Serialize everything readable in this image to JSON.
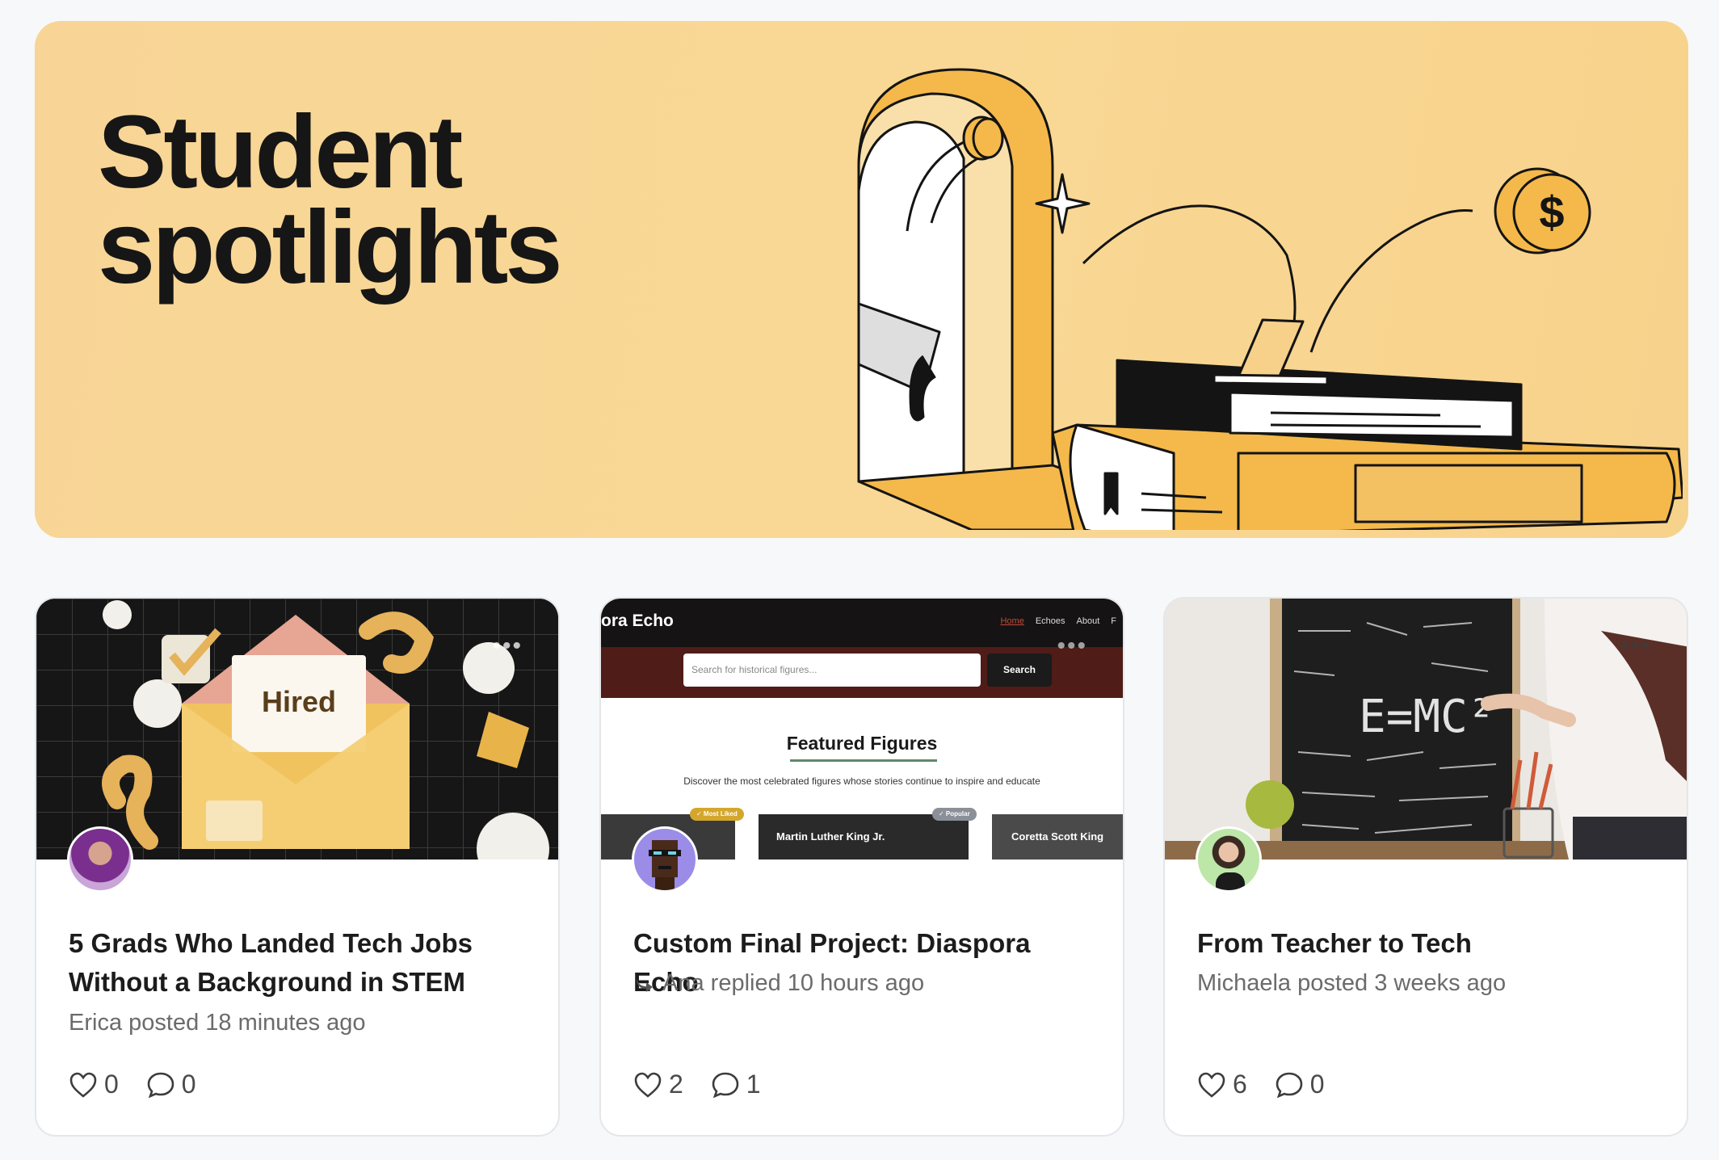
{
  "hero": {
    "title_line1": "Student",
    "title_line2": "spotlights"
  },
  "cards": [
    {
      "title_line1": "5 Grads Who Landed Tech Jobs",
      "title_line2": "Without a Background in STEM",
      "meta": "Erica posted 18 minutes ago",
      "likes": "0",
      "comments": "0",
      "image_label": "Hired"
    },
    {
      "title_line1": "Custom Final Project: Diaspora Echo",
      "meta": "Ana replied 10 hours ago",
      "likes": "2",
      "comments": "1",
      "mock": {
        "brand": "ora Echo",
        "nav": [
          "Home",
          "Echoes",
          "About",
          "F"
        ],
        "search_placeholder": "Search for historical figures...",
        "search_button": "Search",
        "heading": "Featured Figures",
        "subheading": "Discover the most celebrated figures whose stories continue to inspire and educate",
        "tiles": [
          "Martin Luther King Jr.",
          "Coretta Scott King"
        ],
        "badges": [
          "✓ Most Liked",
          "✓ Popular"
        ]
      }
    },
    {
      "title_line1": "From Teacher to Tech",
      "meta": "Michaela posted 3 weeks ago",
      "likes": "6",
      "comments": "0",
      "chalkboard_text": "E=MC²"
    }
  ],
  "colors": {
    "hero_bg": "#f8d596",
    "accent_gold": "#f2b54a",
    "card_border": "#e5e6ea"
  }
}
